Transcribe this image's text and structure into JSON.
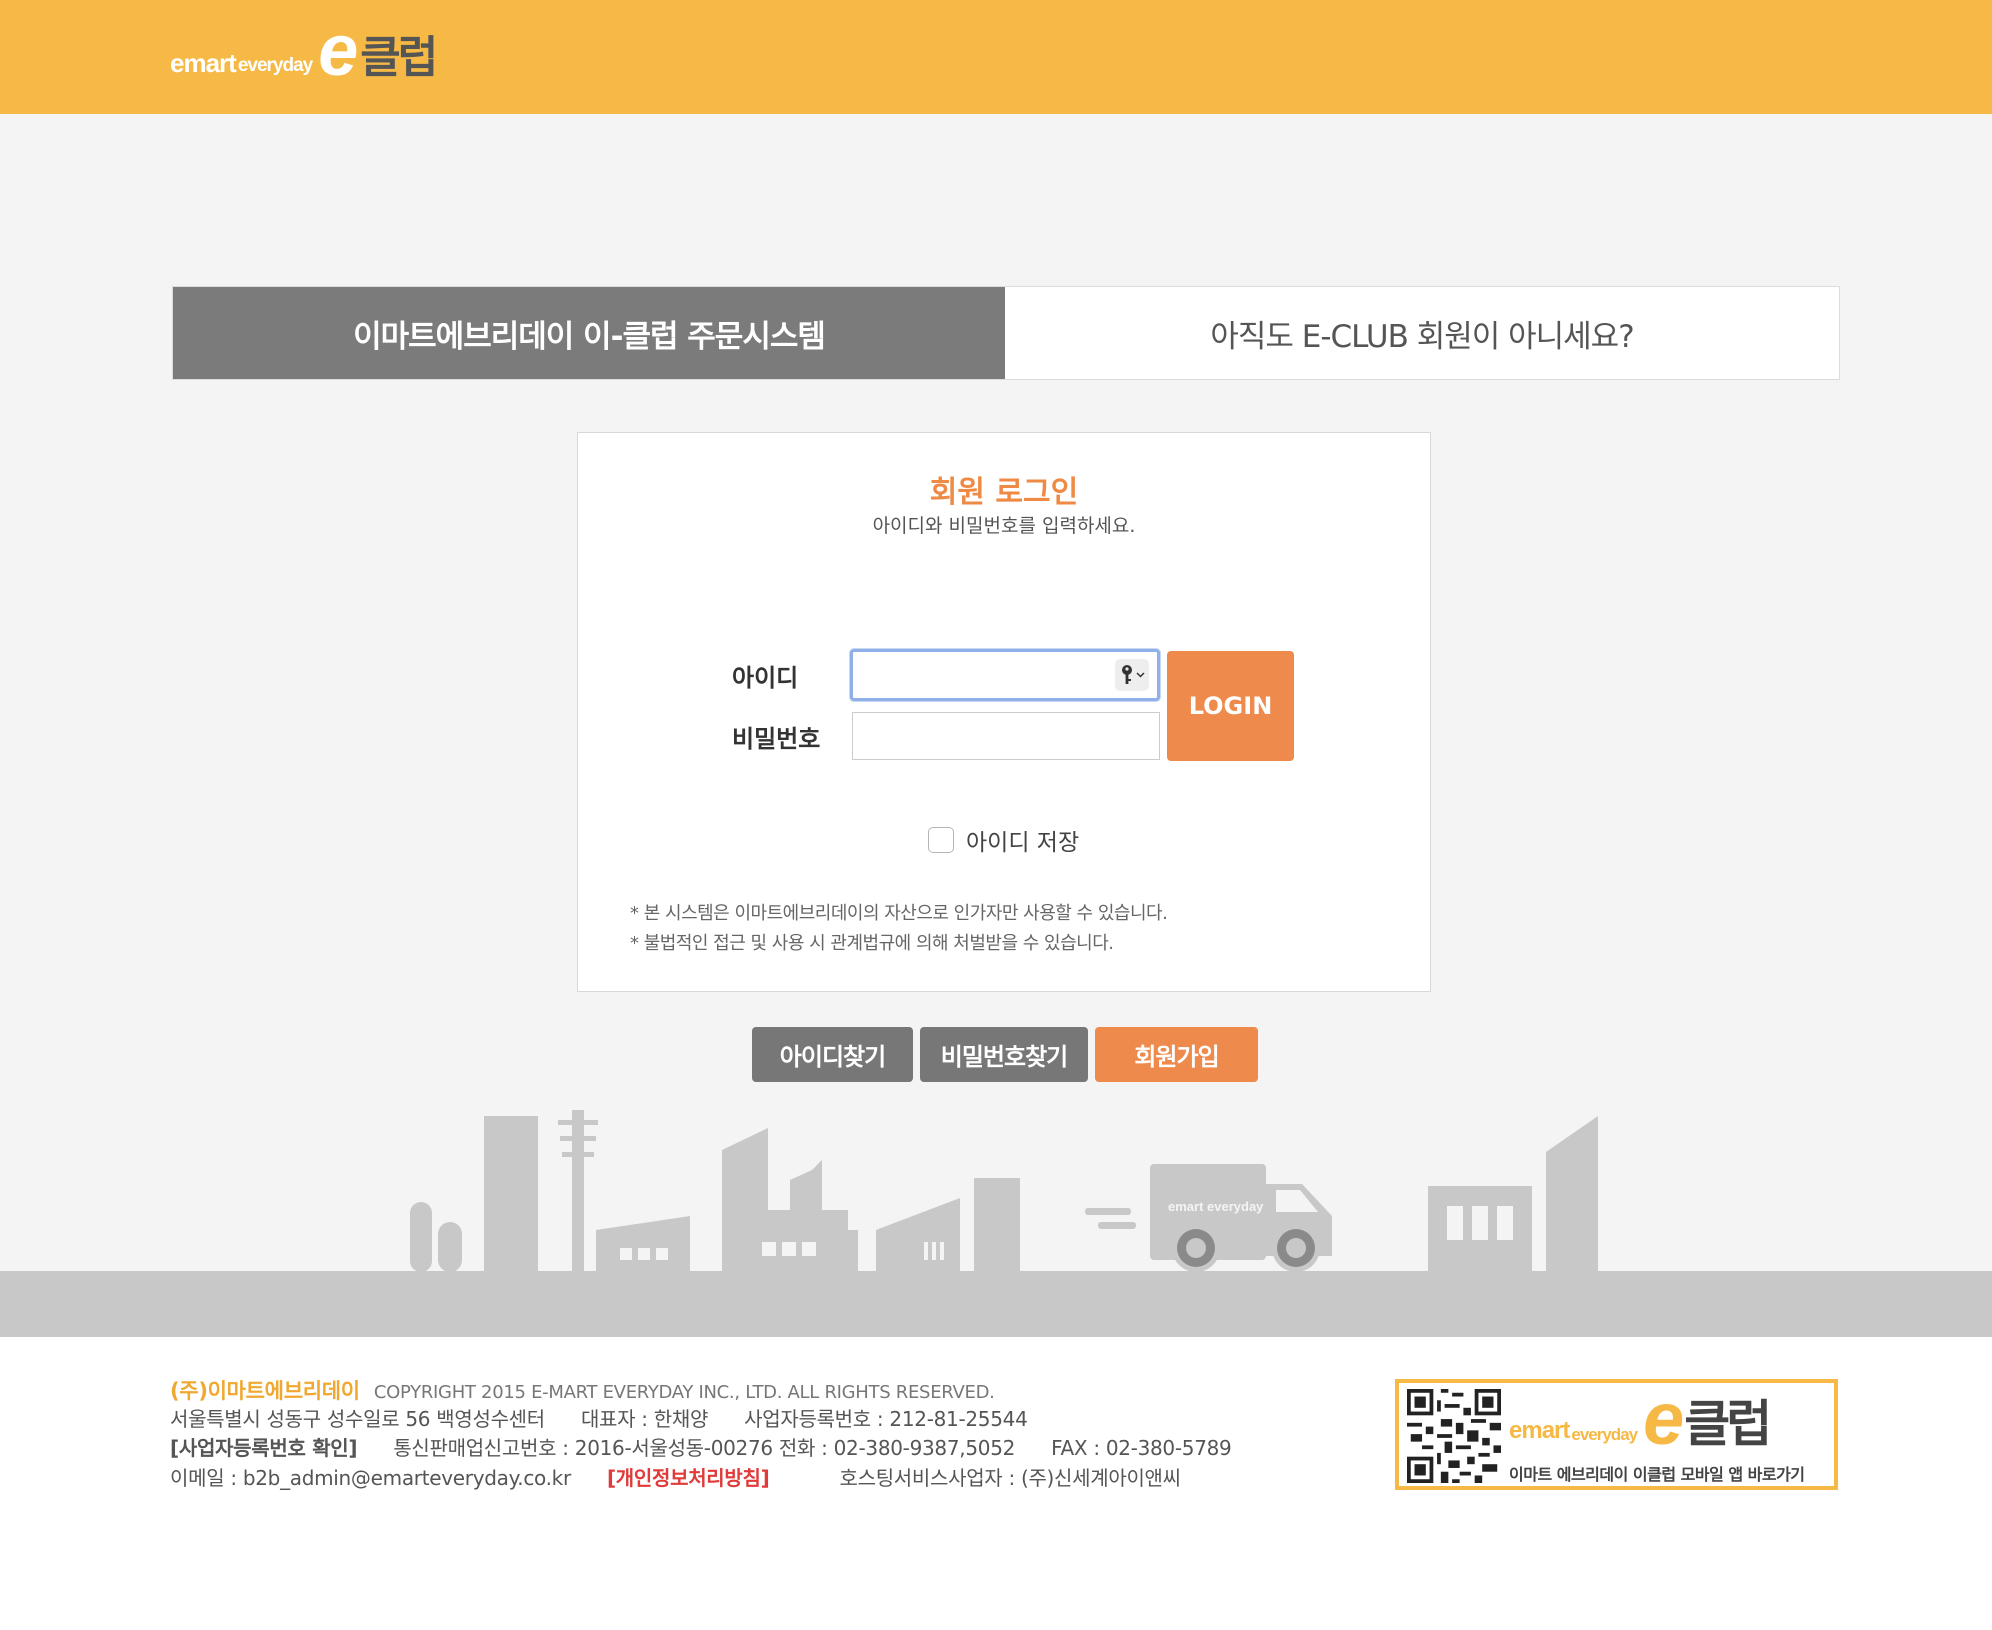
{
  "header": {
    "logo": {
      "emart": "emart",
      "everyday": "everyday",
      "e": "e",
      "club": "클럽"
    }
  },
  "tabs": {
    "active": "이마트에브리데이 이-클럽 주문시스템",
    "signup_prompt": "아직도 E-CLUB 회원이 아니세요?"
  },
  "login": {
    "title": "회원 로그인",
    "subtitle": "아이디와 비밀번호를 입력하세요.",
    "id_label": "아이디",
    "pw_label": "비밀번호",
    "id_value": "",
    "pw_value": "",
    "login_button": "LOGIN",
    "save_id_label": "아이디 저장",
    "save_id_checked": false,
    "notice_1": "* 본 시스템은 이마트에브리데이의 자산으로 인가자만 사용할 수 있습니다.",
    "notice_2": "* 불법적인 접근 및 사용 시 관계법규에 의해 처벌받을 수 있습니다."
  },
  "actions": {
    "find_id": "아이디찾기",
    "find_pw": "비밀번호찾기",
    "join": "회원가입"
  },
  "illustration": {
    "truck_logo": "emart everyday"
  },
  "footer": {
    "company": "(주)이마트에브리데이",
    "copyright": "COPYRIGHT 2015 E-MART EVERYDAY INC., LTD. ALL RIGHTS RESERVED.",
    "address": "서울특별시 성동구 성수일로 56 백영성수센터",
    "ceo": "대표자 : 한채양",
    "biz_no": "사업자등록번호 : 212-81-25544",
    "biz_check": "[사업자등록번호 확인]",
    "mail_order": "통신판매업신고번호 : 2016-서울성동-00276 전화 : 02-380-9387,5052",
    "fax": "FAX : 02-380-5789",
    "email": "이메일 : b2b_admin@emarteveryday.co.kr",
    "privacy": "[개인정보처리방침]",
    "hosting": "호스팅서비스사업자 : (주)신세계아이앤씨"
  },
  "app_banner": {
    "emart": "emart",
    "everyday": "everyday",
    "e": "e",
    "club": "클럽",
    "caption": "이마트 에브리데이 이클럽 모바일 앱 바로가기"
  },
  "colors": {
    "header_bg": "#f6b945",
    "accent_orange": "#ef8a4d",
    "tab_gray": "#7b7b7b",
    "privacy_red": "#e03a3a"
  }
}
